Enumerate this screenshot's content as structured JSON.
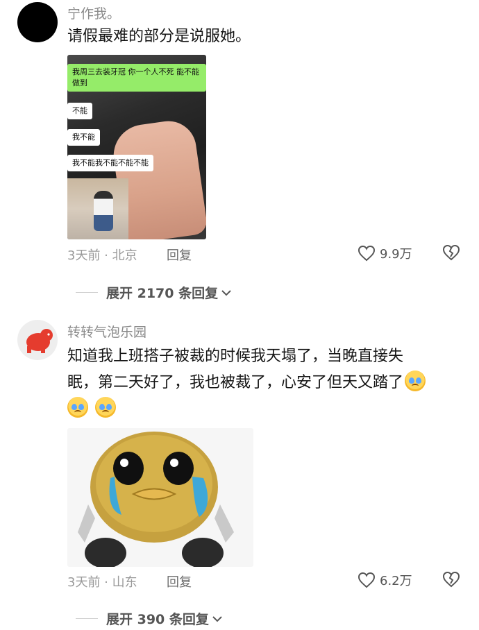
{
  "comments": [
    {
      "username": "宁作我。",
      "text": "请假最难的部分是说服她。",
      "image": {
        "bubbles": [
          "我周三去装牙冠 你一个人不死 能不能做到",
          "不能",
          "我不能",
          "我不能我不能不能不能"
        ]
      },
      "time_location": "3天前 · 北京",
      "reply_label": "回复",
      "likes": "9.9万",
      "expand_label": "展开 2170 条回复"
    },
    {
      "username": "转转气泡乐园",
      "text_line1": "知道我上班搭子被裁的时候我天塌了，当晚直接失",
      "text_line2": "眠，第二天好了，我也被裁了，心安了但天又踏了",
      "time_location": "3天前 · 山东",
      "reply_label": "回复",
      "likes": "6.2万",
      "expand_label": "展开 390 条回复"
    }
  ],
  "icons": {
    "like": "heart-outline-icon",
    "dislike": "broken-heart-icon",
    "expand": "chevron-down-icon",
    "emoji": "crying-face-emoji"
  },
  "colors": {
    "wechat_green": "#95ec69",
    "muted_text": "#9a9a9a"
  }
}
